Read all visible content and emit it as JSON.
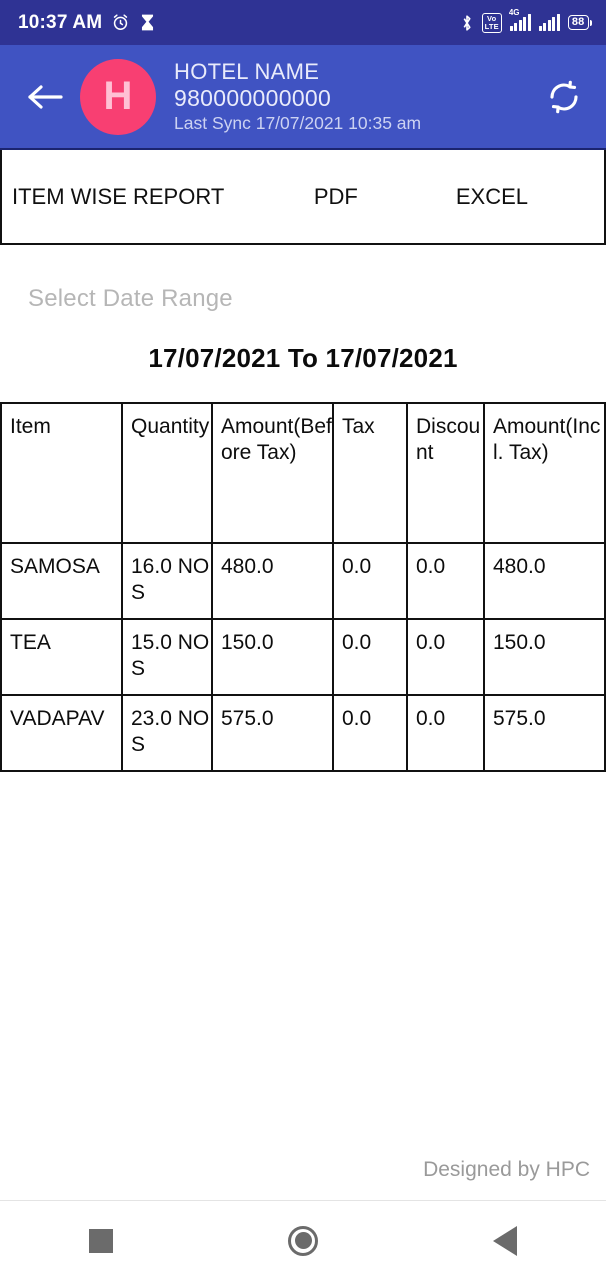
{
  "status_bar": {
    "time": "10:37 AM",
    "alarm_icon": "alarm-clock-icon",
    "hourglass_icon": "hourglass-icon",
    "bluetooth_icon": "bluetooth-icon",
    "volte_top": "Vo",
    "volte_bottom": "LTE",
    "network_type": "4G",
    "battery_percent": "88",
    "background_color": "#2f3394"
  },
  "app_bar": {
    "back_label": "back-arrow",
    "avatar_initial": "H",
    "avatar_color": "#f83f72",
    "hotel_name": "HOTEL NAME",
    "phone": "980000000000",
    "last_sync": "Last Sync 17/07/2021 10:35 am",
    "sync_label": "sync-icon",
    "background_color": "#4053c2"
  },
  "report_bar": {
    "title": "ITEM WISE REPORT",
    "pdf_label": "PDF",
    "excel_label": "EXCEL"
  },
  "date_range": {
    "label": "Select Date Range",
    "value": "17/07/2021 To 17/07/2021"
  },
  "table": {
    "headers": [
      "Item",
      "Quantity",
      "Amount(Before Tax)",
      "Tax",
      "Discount",
      "Amount(Incl. Tax)"
    ],
    "rows": [
      {
        "item": "SAMOSA",
        "quantity": "16.0 NOS",
        "amount_before_tax": "480.0",
        "tax": "0.0",
        "discount": "0.0",
        "amount_incl_tax": "480.0"
      },
      {
        "item": "TEA",
        "quantity": "15.0 NOS",
        "amount_before_tax": "150.0",
        "tax": "0.0",
        "discount": "0.0",
        "amount_incl_tax": "150.0"
      },
      {
        "item": "VADAPAV",
        "quantity": "23.0 NOS",
        "amount_before_tax": "575.0",
        "tax": "0.0",
        "discount": "0.0",
        "amount_incl_tax": "575.0"
      }
    ]
  },
  "footer": {
    "credit": "Designed by HPC"
  },
  "nav_bar": {
    "recents_label": "recents-square-icon",
    "home_label": "home-circle-icon",
    "back_label": "back-triangle-icon"
  }
}
